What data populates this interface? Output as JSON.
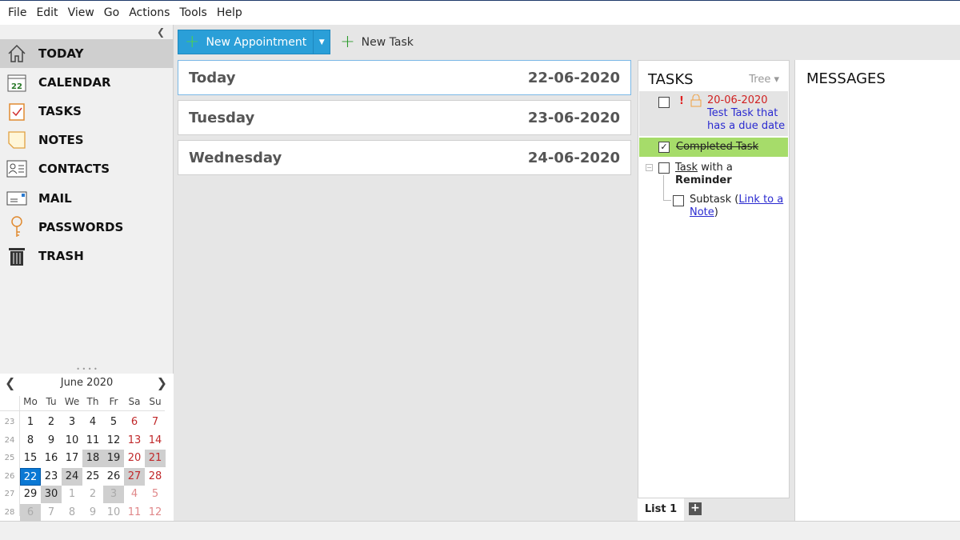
{
  "menu": [
    "File",
    "Edit",
    "View",
    "Go",
    "Actions",
    "Tools",
    "Help"
  ],
  "sidebar": {
    "items": [
      {
        "label": "TODAY",
        "icon": "home-icon",
        "active": true
      },
      {
        "label": "CALENDAR",
        "icon": "calendar-icon",
        "badge": "22"
      },
      {
        "label": "TASKS",
        "icon": "clipboard-check-icon"
      },
      {
        "label": "NOTES",
        "icon": "note-icon"
      },
      {
        "label": "CONTACTS",
        "icon": "contact-card-icon"
      },
      {
        "label": "MAIL",
        "icon": "mail-icon"
      },
      {
        "label": "PASSWORDS",
        "icon": "key-icon"
      },
      {
        "label": "TRASH",
        "icon": "trash-icon"
      }
    ]
  },
  "minical": {
    "title": "June  2020",
    "weekdays": [
      "Mo",
      "Tu",
      "We",
      "Th",
      "Fr",
      "Sa",
      "Su"
    ],
    "weeks": [
      {
        "wk": "23",
        "days": [
          "1",
          "2",
          "3",
          "4",
          "5",
          "6",
          "7"
        ]
      },
      {
        "wk": "24",
        "days": [
          "8",
          "9",
          "10",
          "11",
          "12",
          "13",
          "14"
        ]
      },
      {
        "wk": "25",
        "days": [
          "15",
          "16",
          "17",
          "18",
          "19",
          "20",
          "21"
        ]
      },
      {
        "wk": "26",
        "days": [
          "22",
          "23",
          "24",
          "25",
          "26",
          "27",
          "28"
        ]
      },
      {
        "wk": "27",
        "days": [
          "29",
          "30",
          "1",
          "2",
          "3",
          "4",
          "5"
        ]
      },
      {
        "wk": "28",
        "days": [
          "6",
          "7",
          "8",
          "9",
          "10",
          "11",
          "12"
        ]
      }
    ],
    "selected": "22",
    "highlighted": [
      "18",
      "19",
      "21",
      "24",
      "27",
      "30",
      "3-out",
      "6-out"
    ],
    "accent": "#0a78d4",
    "weekend_color": "#c0282a"
  },
  "toolbar": {
    "new_appointment": "New Appointment",
    "new_task": "New Task"
  },
  "days": [
    {
      "name": "Today",
      "date": "22-06-2020"
    },
    {
      "name": "Tuesday",
      "date": "23-06-2020"
    },
    {
      "name": "Wednesday",
      "date": "24-06-2020"
    }
  ],
  "tasks": {
    "title": "TASKS",
    "view": "Tree",
    "items": [
      {
        "priority": "!",
        "due": "20-06-2020",
        "text": "Test Task that has a due date"
      },
      {
        "text": "Completed Task",
        "done": true
      },
      {
        "link": "Task",
        "text": " with a",
        "bold": "Reminder"
      },
      {
        "text": "Subtask (",
        "link": "Link to a Note",
        "after": ")"
      }
    ],
    "tab": "List 1",
    "completed_color": "#a6dc6a"
  },
  "messages": {
    "title": "MESSAGES"
  }
}
